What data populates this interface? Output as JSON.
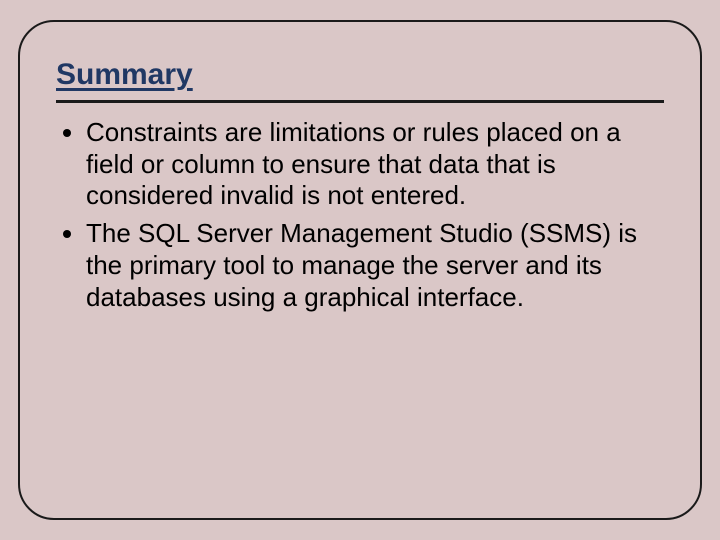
{
  "slide": {
    "title": "Summary",
    "bullets": [
      "Constraints are limitations or rules placed on a field or column to ensure that data that is considered invalid is not entered.",
      "The SQL Server Management Studio (SSMS) is the primary tool to manage the server and its databases using a graphical interface."
    ]
  }
}
